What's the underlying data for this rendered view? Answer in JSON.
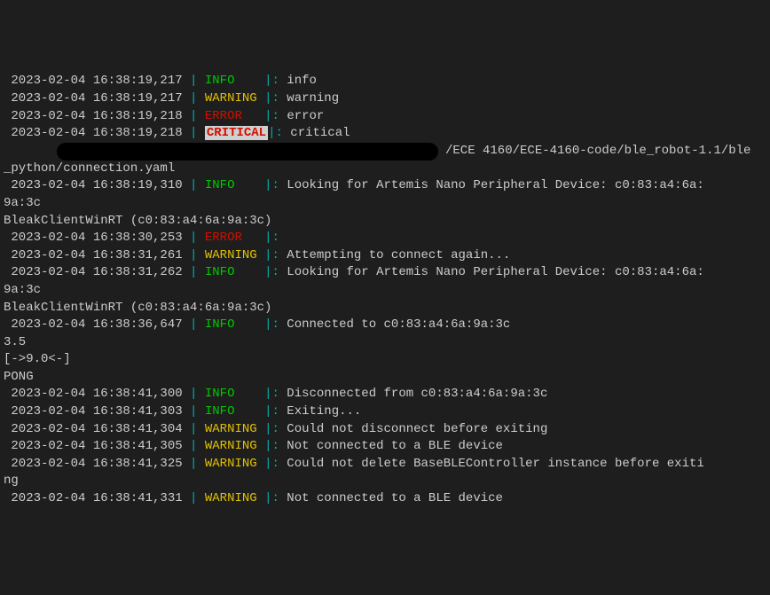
{
  "lines": [
    {
      "type": "log",
      "ts": "2023-02-04 16:38:19,217",
      "level": "INFO",
      "levelClass": "lvl-info",
      "pad": "    ",
      "msg": "info"
    },
    {
      "type": "log",
      "ts": "2023-02-04 16:38:19,217",
      "level": "WARNING",
      "levelClass": "lvl-warning",
      "pad": " ",
      "msg": "warning"
    },
    {
      "type": "log",
      "ts": "2023-02-04 16:38:19,218",
      "level": "ERROR",
      "levelClass": "lvl-error",
      "pad": "   ",
      "msg": "error"
    },
    {
      "type": "log",
      "ts": "2023-02-04 16:38:19,218",
      "level": "CRITICAL",
      "levelClass": "lvl-critical",
      "pad": "",
      "msg": "critical"
    },
    {
      "type": "redacted",
      "text": "/ECE 4160/ECE-4160-code/ble_robot-1.1/ble"
    },
    {
      "type": "plain",
      "text": "_python/connection.yaml"
    },
    {
      "type": "log",
      "ts": "2023-02-04 16:38:19,310",
      "level": "INFO",
      "levelClass": "lvl-info",
      "pad": "    ",
      "msg": "Looking for Artemis Nano Peripheral Device: c0:83:a4:6a:"
    },
    {
      "type": "plain",
      "text": "9a:3c"
    },
    {
      "type": "plain",
      "text": "BleakClientWinRT (c0:83:a4:6a:9a:3c)"
    },
    {
      "type": "log",
      "ts": "2023-02-04 16:38:30,253",
      "level": "ERROR",
      "levelClass": "lvl-error",
      "pad": "   ",
      "msg": ""
    },
    {
      "type": "log",
      "ts": "2023-02-04 16:38:31,261",
      "level": "WARNING",
      "levelClass": "lvl-warning",
      "pad": " ",
      "msg": "Attempting to connect again..."
    },
    {
      "type": "log",
      "ts": "2023-02-04 16:38:31,262",
      "level": "INFO",
      "levelClass": "lvl-info",
      "pad": "    ",
      "msg": "Looking for Artemis Nano Peripheral Device: c0:83:a4:6a:"
    },
    {
      "type": "plain",
      "text": "9a:3c"
    },
    {
      "type": "plain",
      "text": "BleakClientWinRT (c0:83:a4:6a:9a:3c)"
    },
    {
      "type": "log",
      "ts": "2023-02-04 16:38:36,647",
      "level": "INFO",
      "levelClass": "lvl-info",
      "pad": "    ",
      "msg": "Connected to c0:83:a4:6a:9a:3c"
    },
    {
      "type": "plain",
      "text": "3.5"
    },
    {
      "type": "plain",
      "text": "[->9.0<-]"
    },
    {
      "type": "plain",
      "text": "PONG"
    },
    {
      "type": "log",
      "ts": "2023-02-04 16:38:41,300",
      "level": "INFO",
      "levelClass": "lvl-info",
      "pad": "    ",
      "msg": "Disconnected from c0:83:a4:6a:9a:3c"
    },
    {
      "type": "log",
      "ts": "2023-02-04 16:38:41,303",
      "level": "INFO",
      "levelClass": "lvl-info",
      "pad": "    ",
      "msg": "Exiting..."
    },
    {
      "type": "log",
      "ts": "2023-02-04 16:38:41,304",
      "level": "WARNING",
      "levelClass": "lvl-warning",
      "pad": " ",
      "msg": "Could not disconnect before exiting"
    },
    {
      "type": "log",
      "ts": "2023-02-04 16:38:41,305",
      "level": "WARNING",
      "levelClass": "lvl-warning",
      "pad": " ",
      "msg": "Not connected to a BLE device"
    },
    {
      "type": "log",
      "ts": "2023-02-04 16:38:41,325",
      "level": "WARNING",
      "levelClass": "lvl-warning",
      "pad": " ",
      "msg": "Could not delete BaseBLEController instance before exiti"
    },
    {
      "type": "plain",
      "text": "ng"
    },
    {
      "type": "log",
      "ts": "2023-02-04 16:38:41,331",
      "level": "WARNING",
      "levelClass": "lvl-warning",
      "pad": " ",
      "msg": "Not connected to a BLE device"
    }
  ],
  "sep": " | "
}
